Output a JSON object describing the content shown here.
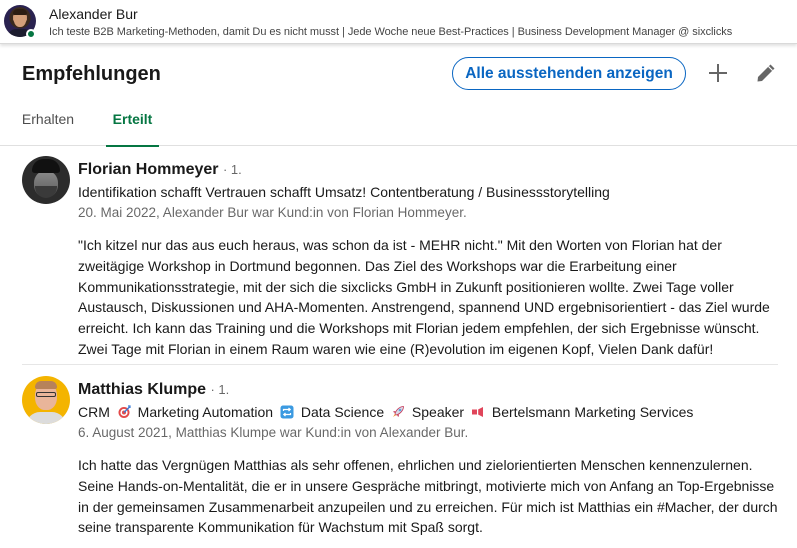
{
  "profile_bar": {
    "name": "Alexander Bur",
    "headline": "Ich teste B2B Marketing-Methoden, damit Du es nicht musst | Jede Woche neue Best-Practices | Business Development Manager @ sixclicks",
    "status": "online",
    "status_color": "#057642"
  },
  "section": {
    "title": "Empfehlungen",
    "pending_button_label": "Alle ausstehenden anzeigen",
    "add_icon": "plus-icon",
    "edit_icon": "pencil-icon",
    "accent_color": "#0a66c2"
  },
  "tabs": [
    {
      "label": "Erhalten",
      "active": false
    },
    {
      "label": "Erteilt",
      "active": true
    }
  ],
  "active_tab_color": "#057642",
  "recommendations": [
    {
      "name": "Florian Hommeyer",
      "degree": "· 1.",
      "headline": "Identifikation schafft Vertrauen schafft Umsatz! Contentberatung / Businessstorytelling",
      "meta": "20. Mai 2022, Alexander Bur war Kund:in von Florian Hommeyer.",
      "text": "\"Ich kitzel nur das aus euch heraus, was schon da ist - MEHR nicht.\" Mit den Worten von Florian hat der zweitägige Workshop in Dortmund begonnen. Das Ziel des Workshops war die Erarbeitung einer Kommunikationsstrategie, mit der sich die sixclicks GmbH in Zukunft positionieren wollte. Zwei Tage voller Austausch, Diskussionen und AHA-Momenten. Anstrengend, spannend UND ergebnisorientiert - das Ziel wurde erreicht. Ich kann das Training und die Workshops mit Florian jedem empfehlen, der sich Ergebnisse wünscht. Zwei Tage mit Florian in einem Raum waren wie eine (R)evolution im eigenen Kopf, Vielen Dank dafür!"
    },
    {
      "name": "Matthias Klumpe",
      "degree": "· 1.",
      "headline_parts": [
        {
          "text": "CRM",
          "icon": null
        },
        {
          "text": "Marketing Automation",
          "icon": "target-emoji-icon"
        },
        {
          "text": "Data Science",
          "icon": "repeat-emoji-icon"
        },
        {
          "text": "Speaker",
          "icon": "rocket-emoji-icon"
        },
        {
          "text": "Bertelsmann Marketing Services",
          "icon": "megaphone-emoji-icon"
        }
      ],
      "meta": "6. August 2021, Matthias Klumpe war Kund:in von Alexander Bur.",
      "text": "Ich hatte das Vergnügen Matthias als sehr offenen, ehrlichen und zielorientierten Menschen kennenzulernen. Seine Hands-on-Mentalität, die er in unsere Gespräche mitbringt, motivierte mich von Anfang an Top-Ergebnisse in der gemeinsamen Zusammenarbeit anzupeilen und zu erreichen. Für mich ist Matthias ein #Macher, der durch seine transparente Kommunikation für Wachstum mit Spaß sorgt."
    }
  ]
}
